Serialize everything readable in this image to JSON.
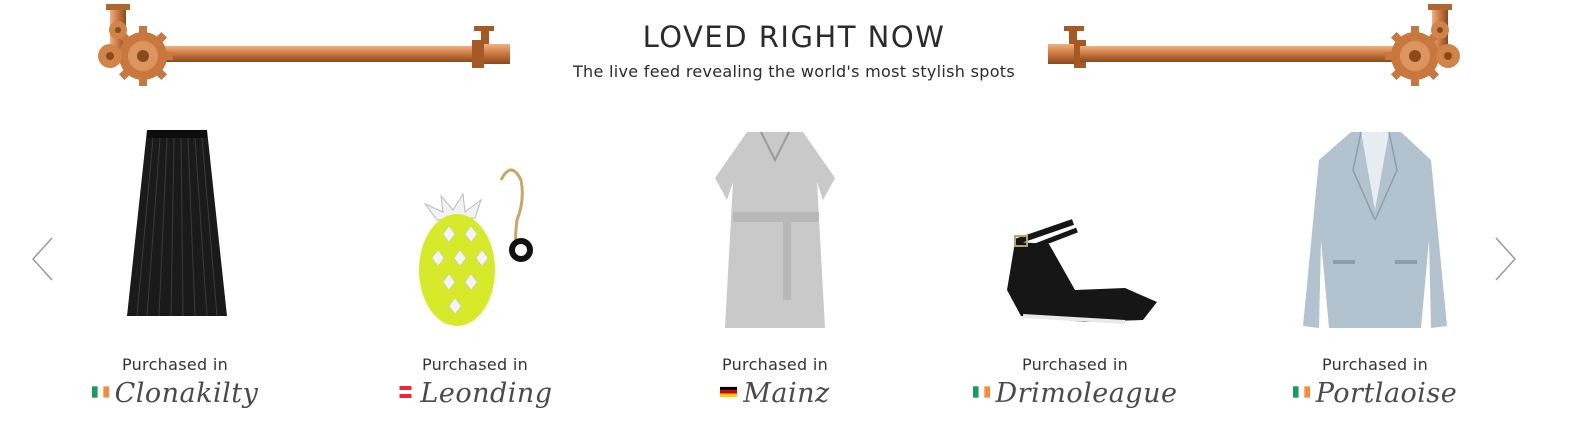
{
  "header": {
    "title": "LOVED RIGHT NOW",
    "subtitle": "The live feed revealing the world's most stylish spots"
  },
  "colors": {
    "copper": "#c8773e",
    "copper_dark": "#9c5424",
    "copper_light": "#e8a070"
  },
  "nav": {
    "prev_icon": "chevron-left-icon",
    "next_icon": "chevron-right-icon"
  },
  "products": [
    {
      "item": "black-pleated-skirt",
      "purchased_label": "Purchased in",
      "city": "Clonakilty",
      "flag": "ireland-flag"
    },
    {
      "item": "pineapple-coin-purse",
      "purchased_label": "Purchased in",
      "city": "Leonding",
      "flag": "austria-flag"
    },
    {
      "item": "grey-wrap-dress",
      "purchased_label": "Purchased in",
      "city": "Mainz",
      "flag": "germany-flag"
    },
    {
      "item": "black-pointed-flats",
      "purchased_label": "Purchased in",
      "city": "Drimoleague",
      "flag": "ireland-flag"
    },
    {
      "item": "light-blue-blazer",
      "purchased_label": "Purchased in",
      "city": "Portlaoise",
      "flag": "ireland-flag"
    }
  ]
}
